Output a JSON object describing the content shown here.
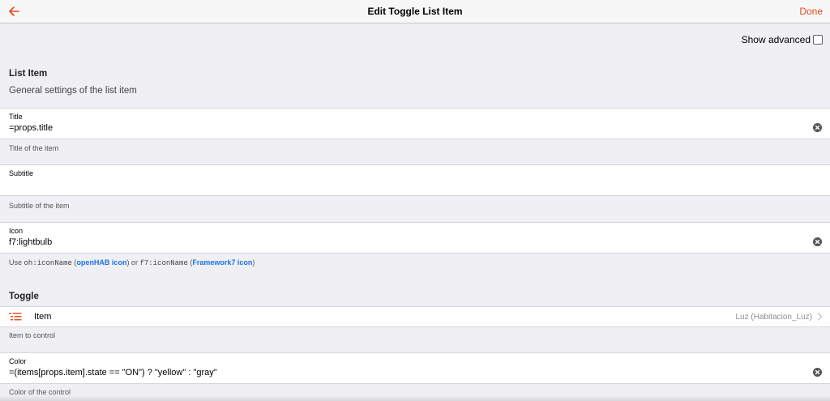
{
  "navbar": {
    "title": "Edit Toggle List Item",
    "done_label": "Done",
    "back_icon": "arrow-left-icon"
  },
  "show_advanced": {
    "label": "Show advanced",
    "checked": false
  },
  "list_item_block": {
    "title": "List Item",
    "description": "General settings of the list item"
  },
  "fields": {
    "title": {
      "label": "Title",
      "value": "=props.title",
      "info": "Title of the item"
    },
    "subtitle": {
      "label": "Subtitle",
      "value": "",
      "info": "Subtitle of the item"
    },
    "icon": {
      "label": "Icon",
      "value": "f7:lightbulb",
      "info": {
        "use": "Use ",
        "code1": "oh:iconName",
        "open_paren1": " (",
        "link1": "openHAB icon",
        "mid": ") or ",
        "code2": "f7:iconName",
        "open_paren2": " (",
        "link2": "Framework7 icon",
        "close": ")"
      }
    },
    "color": {
      "label": "Color",
      "value": "=(items[props.item].state == \"ON\") ? \"yellow\" : \"gray\"",
      "info": "Color of the control"
    }
  },
  "toggle_block": {
    "title": "Toggle",
    "item_row": {
      "icon": "list-icon",
      "label": "Item",
      "value": "Luz (Habitacion_Luz)",
      "info": "Item to control"
    }
  },
  "colors": {
    "accent": "#e64a19",
    "link": "#1a73e8",
    "background": "#efeff4"
  }
}
